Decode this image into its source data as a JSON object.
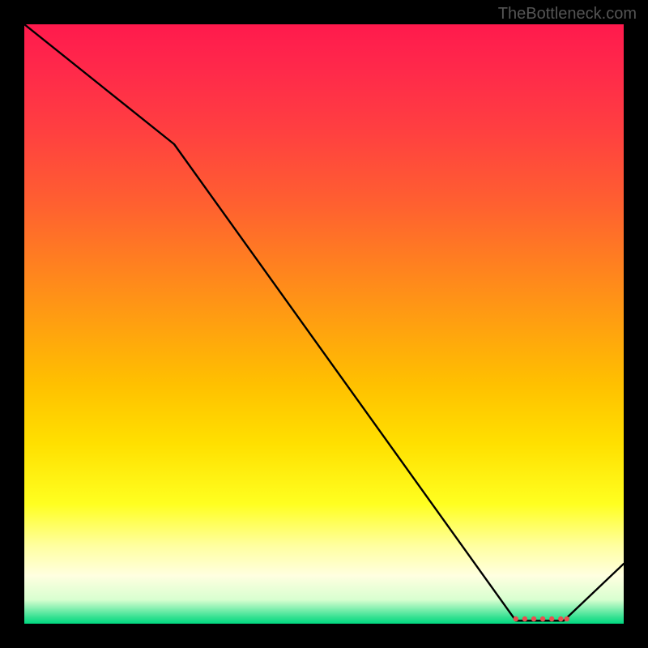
{
  "watermark": "TheBottleneck.com",
  "chart_data": {
    "type": "line",
    "title": "",
    "xlabel": "",
    "ylabel": "",
    "xlim": [
      0,
      100
    ],
    "ylim": [
      0,
      100
    ],
    "series": [
      {
        "name": "curve",
        "x": [
          0,
          25,
          82,
          90,
          100
        ],
        "y": [
          100,
          80,
          0.5,
          0.5,
          10
        ]
      }
    ],
    "markers": {
      "name": "flat-segment-dots",
      "x": [
        82,
        83.5,
        85,
        86.5,
        88,
        89.5,
        90.5
      ],
      "y": [
        0.8,
        0.8,
        0.8,
        0.8,
        0.8,
        0.8,
        0.8
      ]
    },
    "gradient_stops": [
      {
        "pos": 0.0,
        "color": "#ff1a4d"
      },
      {
        "pos": 0.5,
        "color": "#ffa010"
      },
      {
        "pos": 0.8,
        "color": "#ffff20"
      },
      {
        "pos": 0.99,
        "color": "#30e090"
      },
      {
        "pos": 1.0,
        "color": "#00d880"
      }
    ]
  }
}
